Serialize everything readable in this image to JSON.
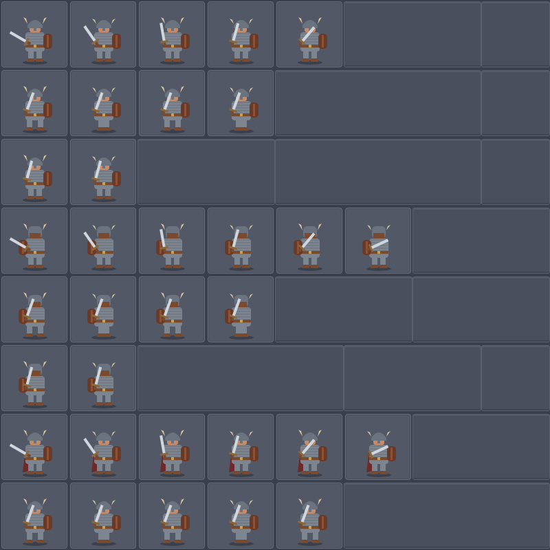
{
  "sheet": {
    "type": "sprite-sheet",
    "subject": "horned-helmet-warrior",
    "columns_max": 8,
    "rows": [
      {
        "name": "attack-front-right",
        "frames": 5,
        "facing": "right",
        "pose": "attack"
      },
      {
        "name": "walk-side",
        "frames": 4,
        "facing": "right",
        "pose": "walk"
      },
      {
        "name": "idle-side",
        "frames": 2,
        "facing": "right",
        "pose": "idle"
      },
      {
        "name": "attack-back",
        "frames": 6,
        "facing": "back",
        "pose": "attack"
      },
      {
        "name": "walk-back",
        "frames": 4,
        "facing": "back",
        "pose": "walk"
      },
      {
        "name": "idle-back",
        "frames": 2,
        "facing": "back",
        "pose": "idle"
      },
      {
        "name": "attack-front",
        "frames": 6,
        "facing": "front",
        "pose": "attack"
      },
      {
        "name": "walk-front",
        "frames": 5,
        "facing": "front",
        "pose": "walk"
      }
    ],
    "colors": {
      "background": "#3a3f4c",
      "cell": "#525866",
      "armor": "#7d8590",
      "helmet": "#6b737e",
      "horn": "#d9c9a0",
      "skin": "#c98a66",
      "leather": "#7a4a2e",
      "sword": "#cfd6de",
      "shield": "#6b3a26",
      "cape": "#6e2a2a"
    }
  }
}
